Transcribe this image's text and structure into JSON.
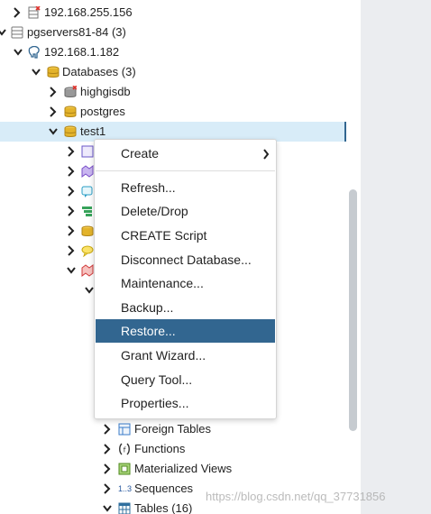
{
  "tree": {
    "nodes": {
      "server_a": "192.168.255.156",
      "group": "pgservers81-84 (3)",
      "server_b": "192.168.1.182",
      "databases": "Databases (3)",
      "db1": "highgisdb",
      "db2": "postgres",
      "db3": "test1",
      "foreign_tables": "Foreign Tables",
      "functions": "Functions",
      "materialized_views": "Materialized Views",
      "sequences": "Sequences",
      "sequences_icon_text": "1..3",
      "tables": "Tables (16)"
    }
  },
  "context_menu": {
    "items": [
      {
        "label": "Create"
      },
      {
        "label": "Refresh..."
      },
      {
        "label": "Delete/Drop"
      },
      {
        "label": "CREATE Script"
      },
      {
        "label": "Disconnect Database..."
      },
      {
        "label": "Maintenance..."
      },
      {
        "label": "Backup..."
      },
      {
        "label": "Restore..."
      },
      {
        "label": "Grant Wizard..."
      },
      {
        "label": "Query Tool..."
      },
      {
        "label": "Properties..."
      }
    ],
    "highlighted": "Restore..."
  },
  "watermark": "https://blog.csdn.net/qq_37731856",
  "colors": {
    "selection_bg": "#d8ecf8",
    "menu_highlight": "#326690",
    "db_icon": "#d9a81e",
    "disconnected_badge": "#e0312b"
  }
}
